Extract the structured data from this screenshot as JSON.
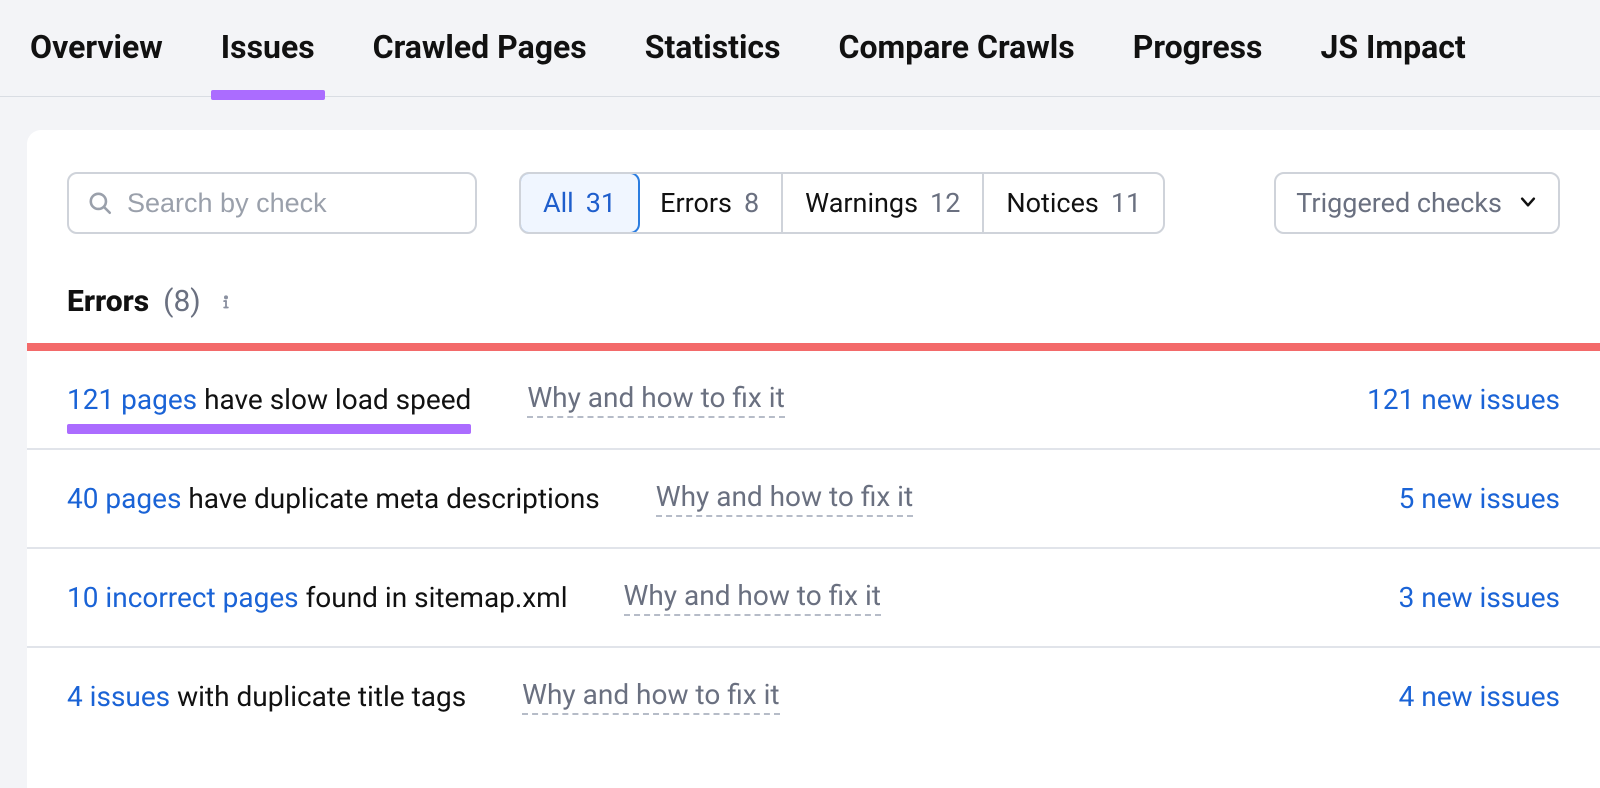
{
  "nav": {
    "items": [
      {
        "label": "Overview"
      },
      {
        "label": "Issues",
        "active": true
      },
      {
        "label": "Crawled Pages"
      },
      {
        "label": "Statistics"
      },
      {
        "label": "Compare Crawls"
      },
      {
        "label": "Progress"
      },
      {
        "label": "JS Impact"
      }
    ]
  },
  "search": {
    "placeholder": "Search by check"
  },
  "filters": [
    {
      "label": "All",
      "count": "31",
      "active": true
    },
    {
      "label": "Errors",
      "count": "8"
    },
    {
      "label": "Warnings",
      "count": "12"
    },
    {
      "label": "Notices",
      "count": "11"
    }
  ],
  "triggered": {
    "label": "Triggered checks"
  },
  "section": {
    "title": "Errors",
    "count": "(8)"
  },
  "fix_label": "Why and how to fix it",
  "issues": [
    {
      "link": "121 pages",
      "text": " have slow load speed",
      "new": "121 new issues"
    },
    {
      "link": "40 pages",
      "text": " have duplicate meta descriptions",
      "new": "5 new issues"
    },
    {
      "link": "10 incorrect pages",
      "text": " found in sitemap.xml",
      "new": "3 new issues"
    },
    {
      "link": "4 issues",
      "text": " with duplicate title tags",
      "new": "4 new issues"
    }
  ]
}
